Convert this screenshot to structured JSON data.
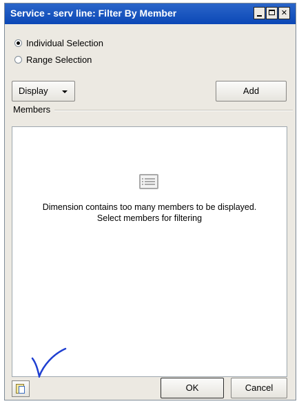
{
  "window": {
    "title": "Service - serv line: Filter By Member"
  },
  "selection_mode": {
    "options": [
      {
        "label": "Individual Selection",
        "checked": true
      },
      {
        "label": "Range Selection",
        "checked": false
      }
    ]
  },
  "toolbar": {
    "display_label": "Display",
    "add_label": "Add"
  },
  "members": {
    "label": "Members",
    "empty_message_line1": "Dimension contains too many members to be displayed.",
    "empty_message_line2": "Select members for filtering"
  },
  "footer": {
    "ok_label": "OK",
    "cancel_label": "Cancel"
  },
  "colors": {
    "titlebar": "#0b47b6",
    "annotation": "#1f3fd1"
  },
  "icons": [
    "list-icon",
    "member-select-icon",
    "minimize-icon",
    "maximize-icon",
    "close-icon"
  ]
}
